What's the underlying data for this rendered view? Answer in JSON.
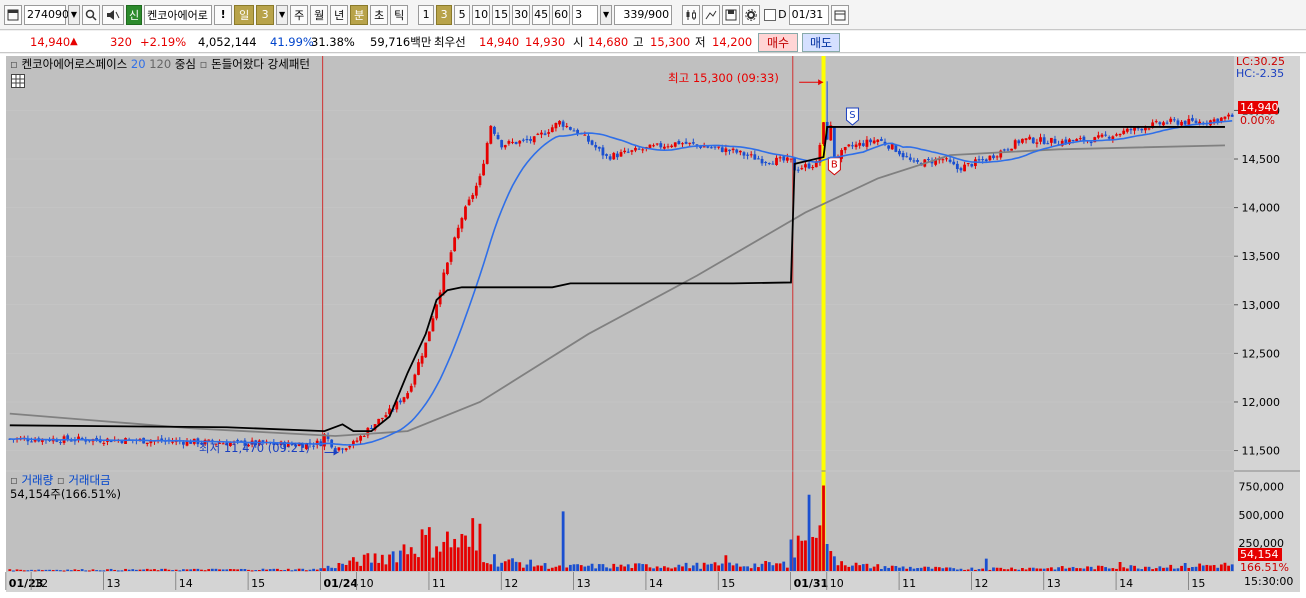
{
  "toolbar": {
    "code": "274090",
    "stock_badge": "신",
    "stock_name": "켄코아에어로",
    "warn": "!",
    "period_selected": "일",
    "period_num": "3",
    "periods": [
      "주",
      "월",
      "년"
    ],
    "minute": "분",
    "second": "초",
    "tick": "틱",
    "intervals": [
      "1",
      "3",
      "5",
      "10",
      "15",
      "30",
      "45",
      "60"
    ],
    "interval_selected": "3",
    "count_sel": "3",
    "count": "339/900",
    "checkbox_label": "D",
    "date": "01/31"
  },
  "info": {
    "price": "14,940",
    "arrow": "▲",
    "change": "320",
    "pct": "+2.19%",
    "volume": "4,052,144",
    "ratio1": "41.99%",
    "ratio2": "31.38%",
    "amount": "59,716백만",
    "bestbid_label": "최우선",
    "bid1": "14,940",
    "bid2": "14,930",
    "open_label": "시",
    "open": "14,680",
    "high_label": "고",
    "high": "15,300",
    "low_label": "저",
    "low": "14,200",
    "buy": "매수",
    "sell": "매도"
  },
  "legend": {
    "name": "켄코아에어로스페이스",
    "ma1": "20",
    "ma2": "120",
    "center": "중심",
    "ind1": "돈들어왔다",
    "ind2": "강세패턴"
  },
  "annot": {
    "high": "최고 15,300 (09:33)",
    "low": "최저 11,470 (09:21)",
    "lc": "LC:30.25",
    "hc": "HC:-2.35",
    "cur_price": "14,940",
    "cur_pct": "0.00%",
    "vol_title": "거래량",
    "amt_title": "거래대금",
    "vol_now": "54,154주(166.51%)",
    "vol_tag": "54,154",
    "vol_pct_tag": "166.51%",
    "time": "15:30:00"
  },
  "colors": {
    "up": "#e60000",
    "down": "#1a4fd0",
    "bg": "#c0c0c0",
    "ma20": "#2f6fe8",
    "ma120": "#808080",
    "center": "#000000",
    "cursor": "#ffff00"
  },
  "chart_data": {
    "type": "candlestick",
    "y_ticks": [
      "15,000",
      "14,500",
      "14,000",
      "13,500",
      "13,000",
      "12,500",
      "12,000",
      "11,500"
    ],
    "y_tick_values": [
      15000,
      14500,
      14000,
      13500,
      13000,
      12500,
      12000,
      11500
    ],
    "ylim": [
      11300,
      15560
    ],
    "vol_ticks": [
      "750,000",
      "500,000",
      "250,000"
    ],
    "vol_tick_values": [
      750000,
      500000,
      250000
    ],
    "vol_max": 880000,
    "x_labels": [
      {
        "t": "01/23",
        "i": 0,
        "bold": true
      },
      {
        "t": "12",
        "i": 7
      },
      {
        "t": "13",
        "i": 27
      },
      {
        "t": "14",
        "i": 47
      },
      {
        "t": "15",
        "i": 67
      },
      {
        "t": "01/24",
        "i": 87,
        "bold": true
      },
      {
        "t": "10",
        "i": 97
      },
      {
        "t": "11",
        "i": 117
      },
      {
        "t": "12",
        "i": 137
      },
      {
        "t": "13",
        "i": 157
      },
      {
        "t": "14",
        "i": 177
      },
      {
        "t": "15",
        "i": 197
      },
      {
        "t": "01/31",
        "i": 217,
        "bold": true
      },
      {
        "t": "10",
        "i": 227
      },
      {
        "t": "11",
        "i": 247
      },
      {
        "t": "12",
        "i": 267
      },
      {
        "t": "13",
        "i": 287
      },
      {
        "t": "14",
        "i": 307
      },
      {
        "t": "15",
        "i": 327
      }
    ],
    "anchors": [
      [
        0,
        11620
      ],
      [
        30,
        11610
      ],
      [
        60,
        11580
      ],
      [
        80,
        11560
      ],
      [
        86,
        11580
      ],
      [
        87,
        11660
      ],
      [
        90,
        11520
      ],
      [
        95,
        11570
      ],
      [
        100,
        11750
      ],
      [
        105,
        11900
      ],
      [
        110,
        12100
      ],
      [
        115,
        12600
      ],
      [
        120,
        13300
      ],
      [
        125,
        13900
      ],
      [
        130,
        14300
      ],
      [
        133,
        14850
      ],
      [
        136,
        14650
      ],
      [
        145,
        14700
      ],
      [
        152,
        14880
      ],
      [
        158,
        14750
      ],
      [
        165,
        14520
      ],
      [
        175,
        14600
      ],
      [
        185,
        14670
      ],
      [
        200,
        14580
      ],
      [
        208,
        14490
      ],
      [
        216,
        14480
      ],
      [
        217,
        14400
      ],
      [
        223,
        14450
      ],
      [
        225,
        14850
      ],
      [
        226,
        15150
      ],
      [
        228,
        14500
      ],
      [
        232,
        14620
      ],
      [
        240,
        14700
      ],
      [
        245,
        14600
      ],
      [
        250,
        14450
      ],
      [
        258,
        14500
      ],
      [
        262,
        14400
      ],
      [
        270,
        14500
      ],
      [
        280,
        14700
      ],
      [
        290,
        14680
      ],
      [
        300,
        14700
      ],
      [
        310,
        14800
      ],
      [
        320,
        14880
      ],
      [
        330,
        14880
      ],
      [
        338,
        14940
      ]
    ],
    "vol_anchors": [
      [
        0,
        10000
      ],
      [
        85,
        15000
      ],
      [
        92,
        60000
      ],
      [
        105,
        140000
      ],
      [
        115,
        280000
      ],
      [
        125,
        250000
      ],
      [
        135,
        90000
      ],
      [
        145,
        60000
      ],
      [
        150,
        40000
      ],
      [
        200,
        50000
      ],
      [
        215,
        60000
      ],
      [
        225,
        700000
      ],
      [
        227,
        120000
      ],
      [
        235,
        45000
      ],
      [
        260,
        20000
      ],
      [
        300,
        30000
      ],
      [
        338,
        54154
      ]
    ],
    "spikes": [
      [
        216,
        280000
      ],
      [
        217,
        120000
      ],
      [
        225,
        760000
      ],
      [
        226,
        240000
      ],
      [
        153,
        530000
      ],
      [
        128,
        470000
      ],
      [
        130,
        420000
      ],
      [
        116,
        390000
      ],
      [
        198,
        140000
      ],
      [
        270,
        110000
      ],
      [
        307,
        80000
      ]
    ],
    "center_line": [
      [
        0,
        11760
      ],
      [
        60,
        11740
      ],
      [
        87,
        11700
      ],
      [
        92,
        11770
      ],
      [
        95,
        11700
      ],
      [
        100,
        11700
      ],
      [
        105,
        11850
      ],
      [
        110,
        12300
      ],
      [
        115,
        12700
      ],
      [
        118,
        13050
      ],
      [
        121,
        13150
      ],
      [
        125,
        13180
      ],
      [
        150,
        13180
      ],
      [
        155,
        13220
      ],
      [
        200,
        13220
      ],
      [
        216,
        13230
      ],
      [
        217,
        14450
      ],
      [
        225,
        14520
      ],
      [
        226,
        14830
      ],
      [
        336,
        14830
      ]
    ],
    "ma120_anchors": [
      [
        0,
        11880
      ],
      [
        20,
        11820
      ],
      [
        50,
        11730
      ],
      [
        90,
        11650
      ],
      [
        110,
        11700
      ],
      [
        130,
        12000
      ],
      [
        160,
        12700
      ],
      [
        190,
        13300
      ],
      [
        220,
        13950
      ],
      [
        240,
        14300
      ],
      [
        260,
        14540
      ],
      [
        290,
        14600
      ],
      [
        336,
        14640
      ]
    ]
  }
}
